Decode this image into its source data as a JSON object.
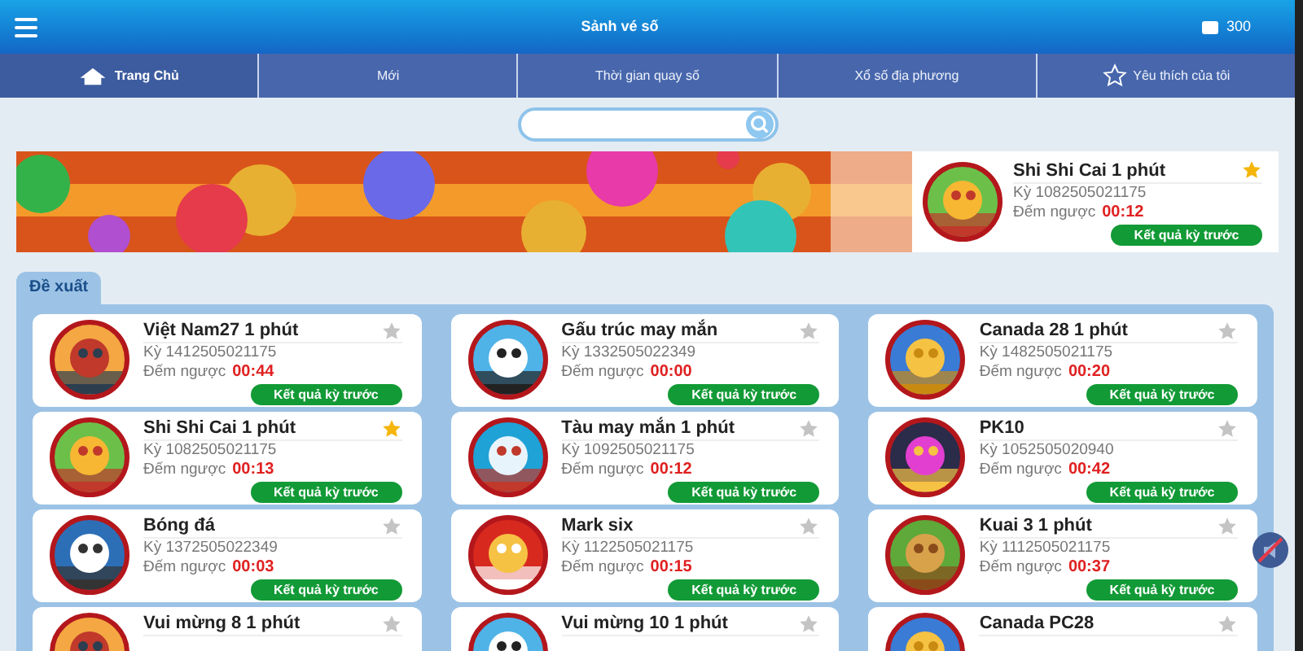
{
  "header": {
    "title": "Sảnh vé số",
    "balance": "300"
  },
  "nav": [
    {
      "label": "Trang Chủ",
      "selected": true
    },
    {
      "label": "Mới",
      "selected": false
    },
    {
      "label": "Thời gian quay số",
      "selected": false
    },
    {
      "label": "Xổ số địa phương",
      "selected": false
    },
    {
      "label": "Yêu thích của tôi",
      "selected": false
    }
  ],
  "featured": {
    "title": "Shi Shi Cai 1 phút",
    "period": "Kỳ 1082505021175",
    "countdown_label": "Đếm ngược",
    "countdown": "00:12",
    "favorite": true,
    "button": "Kết quả kỳ trước"
  },
  "section_tab": "Đề xuất",
  "games": [
    {
      "title": "Việt Nam27 1 phút",
      "period": "Kỳ 1412505021175",
      "countdown_label": "Đếm ngược",
      "countdown": "00:44",
      "favorite": false,
      "button": "Kết quả kỳ trước"
    },
    {
      "title": "Gấu trúc may mắn",
      "period": "Kỳ 1332505022349",
      "countdown_label": "Đếm ngược",
      "countdown": "00:00",
      "favorite": false,
      "button": "Kết quả kỳ trước"
    },
    {
      "title": "Canada 28 1 phút",
      "period": "Kỳ 1482505021175",
      "countdown_label": "Đếm ngược",
      "countdown": "00:20",
      "favorite": false,
      "button": "Kết quả kỳ trước"
    },
    {
      "title": "Shi Shi Cai 1 phút",
      "period": "Kỳ 1082505021175",
      "countdown_label": "Đếm ngược",
      "countdown": "00:13",
      "favorite": true,
      "button": "Kết quả kỳ trước"
    },
    {
      "title": "Tàu may mắn 1 phút",
      "period": "Kỳ 1092505021175",
      "countdown_label": "Đếm ngược",
      "countdown": "00:12",
      "favorite": false,
      "button": "Kết quả kỳ trước"
    },
    {
      "title": "PK10",
      "period": "Kỳ 1052505020940",
      "countdown_label": "Đếm ngược",
      "countdown": "00:42",
      "favorite": false,
      "button": "Kết quả kỳ trước"
    },
    {
      "title": "Bóng đá",
      "period": "Kỳ 1372505022349",
      "countdown_label": "Đếm ngược",
      "countdown": "00:03",
      "favorite": false,
      "button": "Kết quả kỳ trước"
    },
    {
      "title": "Mark six",
      "period": "Kỳ 1122505021175",
      "countdown_label": "Đếm ngược",
      "countdown": "00:15",
      "favorite": false,
      "button": "Kết quả kỳ trước"
    },
    {
      "title": "Kuai 3 1 phút",
      "period": "Kỳ 1112505021175",
      "countdown_label": "Đếm ngược",
      "countdown": "00:37",
      "favorite": false,
      "button": "Kết quả kỳ trước"
    },
    {
      "title": "Vui mừng 8 1 phút",
      "favorite": false
    },
    {
      "title": "Vui mừng 10 1 phút",
      "favorite": false
    },
    {
      "title": "Canada PC28",
      "favorite": false
    }
  ]
}
